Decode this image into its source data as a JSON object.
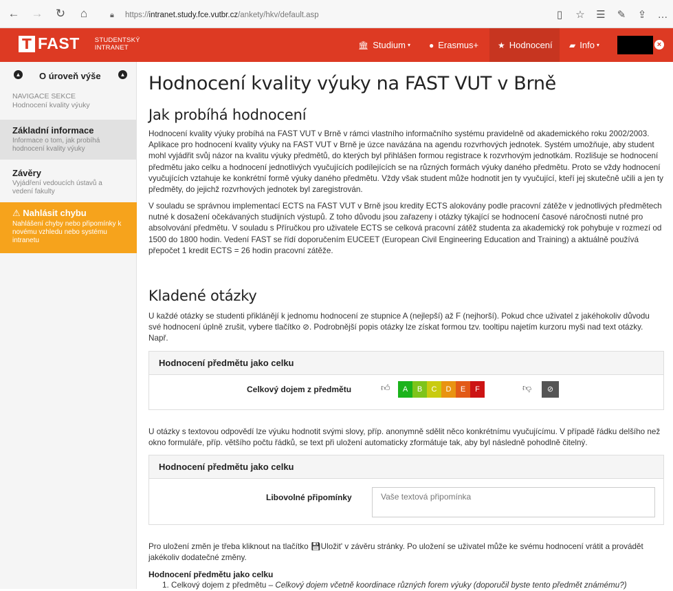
{
  "browser": {
    "url_prefix": "https://",
    "url_host": "intranet.study.fce.vutbr.cz",
    "url_path": "/ankety/hkv/default.asp"
  },
  "appnav": {
    "logo_text": "FAST",
    "logo_sub_line1": "STUDENTSKÝ",
    "logo_sub_line2": "INTRANET",
    "items": [
      {
        "label": "Studium",
        "icon": "building-icon"
      },
      {
        "label": "Erasmus+",
        "icon": "globe-icon"
      },
      {
        "label": "Hodnocení",
        "icon": "star-icon"
      },
      {
        "label": "Info",
        "icon": "book-icon"
      }
    ]
  },
  "sidebar": {
    "up_label": "O úroveň výše",
    "section_title": "NAVIGACE SEKCE",
    "section_sub": "Hodnocení kvality výuky",
    "items": [
      {
        "title": "Základní informace",
        "desc": "Informace o tom, jak probíhá hodnocení kvality výuky"
      },
      {
        "title": "Závěry",
        "desc": "Vyjádření vedoucích ústavů a vedení fakulty"
      },
      {
        "title": "Nahlásit chybu",
        "desc": "Nahlášení chyby nebo připomínky k novému vzhledu nebo systému intranetu"
      }
    ]
  },
  "main": {
    "title": "Hodnocení kvality výuky na FAST VUT v Brně",
    "h2_process": "Jak probíhá hodnocení",
    "p1": "Hodnocení kvality výuky probíhá na FAST VUT v Brně v rámci vlastního informačního systému pravidelně od akademického roku 2002/2003. Aplikace pro hodnocení kvality výuky na FAST VUT v Brně je úzce navázána na agendu rozvrhových jednotek. Systém umožňuje, aby student mohl vyjádřit svůj názor na kvalitu výuky předmětů, do kterých byl přihlášen formou registrace k rozvrhovým jednotkám. Rozlišuje se hodnocení předmětu jako celku a hodnocení jednotlivých vyučujících podílejících se na různých formách výuky daného předmětu. Proto se vždy hodnocení vyučujících vztahuje ke konkrétní formě výuky daného předmětu. Vždy však student může hodnotit jen ty vyučující, kteří jej skutečně učili a jen ty předměty, do jejichž rozvrhových jednotek byl zaregistrován.",
    "p2": "V souladu se správnou implementací ECTS na FAST VUT v Brně jsou kredity ECTS alokovány podle pracovní zátěže v jednotlivých předmětech nutné k dosažení očekávaných studijních výstupů. Z toho důvodu jsou zařazeny i otázky týkající se hodnocení časové náročnosti nutné pro absolvování předmětu. V souladu s Příručkou pro uživatele ECTS se celková pracovní zátěž studenta za akademický rok pohybuje v rozmezí od 1500 do 1800 hodin. Vedení FAST se řídí doporučením EUCEET (European Civil Engineering Education and Training) a aktuálně používá přepočet 1 kredit ECTS = 26 hodin pracovní zátěže.",
    "h2_questions": "Kladené otázky",
    "p3_a": "U každé otázky se studenti přiklánějí k jednomu hodnocení ze stupnice A (nejlepší) až F (nejhorší). Pokud chce uživatel z jakéhokoliv důvodu své hodnocení úplně zrušit, vybere tlačítko ",
    "p3_b": ". Podrobnější popis otázky lze získat formou tzv. tooltipu najetím kurzoru myši nad text otázky. Např.",
    "panel1": {
      "head": "Hodnocení předmětu jako celku",
      "question": "Celkový dojem z předmětu",
      "grades": [
        "A",
        "B",
        "C",
        "D",
        "E",
        "F"
      ],
      "grade_colors": [
        "#1bb31b",
        "#7ec41b",
        "#c9cb10",
        "#e99311",
        "#e25a17",
        "#cc1414"
      ],
      "null_label": "⊘"
    },
    "p4": "U otázky s textovou odpovědí lze výuku hodnotit svými slovy, příp. anonymně sdělit něco konkrétnímu vyučujícímu. V případě řádku delšího než okno formuláře, příp. většího počtu řádků, se text při uložení automaticky zformátuje tak, aby byl následně pohodlně čitelný.",
    "panel2": {
      "head": "Hodnocení předmětu jako celku",
      "question": "Libovolné připomínky",
      "placeholder": "Vaše textová připomínka"
    },
    "p5_a": "Pro uložení změn je třeba kliknout na tlačítko ",
    "p5_b": "Uložit' v závěru stránky. Po uložení se uživatel může ke svému hodnocení vrátit a provádět jakékoliv dodatečné změny.",
    "q_heading": "Hodnocení předmětu jako celku",
    "q1_num": "1.",
    "q1_title": "Celkový dojem z předmětu – ",
    "q1_desc": "Celkový dojem včetně koordinace různých forem výuky (doporučil byste tento předmět známému?)"
  }
}
